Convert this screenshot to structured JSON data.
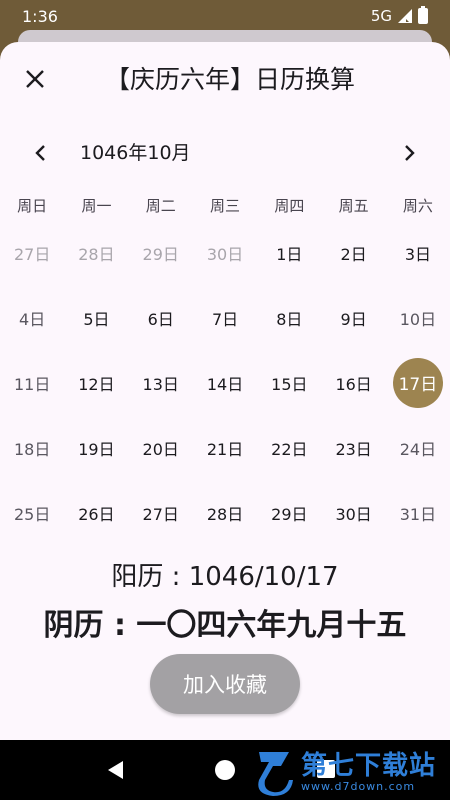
{
  "status_bar": {
    "time": "1:36",
    "network": "5G"
  },
  "dialog": {
    "title": "【庆历六年】日历换算",
    "month_label": "1046年10月",
    "weekdays": [
      "周日",
      "周一",
      "周二",
      "周三",
      "周四",
      "周五",
      "周六"
    ],
    "days": [
      "27日",
      "28日",
      "29日",
      "30日",
      "1日",
      "2日",
      "3日",
      "4日",
      "5日",
      "6日",
      "7日",
      "8日",
      "9日",
      "10日",
      "11日",
      "12日",
      "13日",
      "14日",
      "15日",
      "16日",
      "17日",
      "18日",
      "19日",
      "20日",
      "21日",
      "22日",
      "23日",
      "24日",
      "25日",
      "26日",
      "27日",
      "28日",
      "29日",
      "30日",
      "31日"
    ],
    "selected_day": "17日",
    "solar_line": "阳历 : 1046/10/17",
    "lunar_line": "阴历 : 一〇四六年九月十五",
    "favorite_button": "加入收藏"
  },
  "watermark": {
    "name": "第七下载站",
    "url": "www.d7down.com"
  },
  "colors": {
    "accent": "#9d8450",
    "header": "#6f5b38",
    "sheet": "#fdf7fd"
  }
}
